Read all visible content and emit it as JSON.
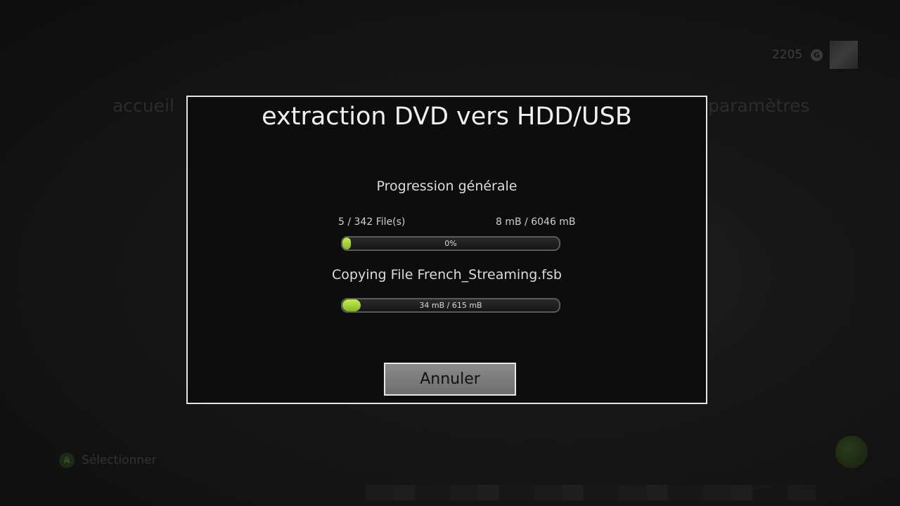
{
  "background": {
    "gamerscore": "2205",
    "gamerscore_icon": "G",
    "nav_left": "accueil",
    "nav_right": "paramètres",
    "select_button": "A",
    "select_label": "Sélectionner"
  },
  "dialog": {
    "title": "extraction DVD vers HDD/USB",
    "overall": {
      "section_title": "Progression générale",
      "files_count": "5 / 342 File(s)",
      "size_count": "8 mB / 6046 mB",
      "progress_label": "0%",
      "progress_fraction": 0.04
    },
    "current_file": {
      "section_title": "Copying File French_Streaming.fsb",
      "progress_label": "34 mB / 615 mB",
      "progress_fraction": 0.085
    },
    "cancel_label": "Annuler"
  },
  "colors": {
    "progress_fill": "#a8d63a",
    "dialog_border": "#e4e4e4",
    "button_bg": "#7c7c7c"
  }
}
